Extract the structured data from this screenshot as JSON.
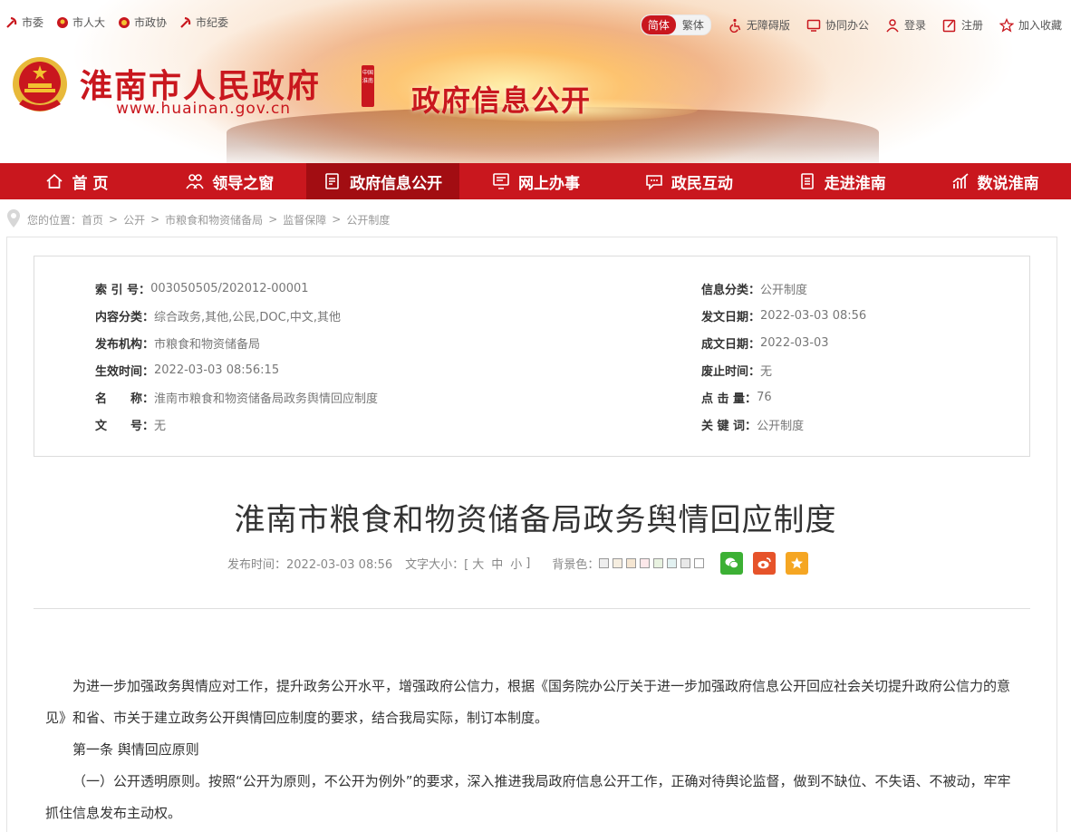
{
  "top_links": [
    "市委",
    "市人大",
    "市政协",
    "市纪委"
  ],
  "lang": {
    "simplified": "简体",
    "traditional": "繁体"
  },
  "top_right": {
    "accessibility": "无障碍版",
    "office": "协同办公",
    "login": "登录",
    "register": "注册",
    "favorite": "加入收藏"
  },
  "logo": {
    "title": "淮南市人民政府",
    "url": "www.huainan.gov.cn",
    "seal": "中国淮南",
    "site_title": "政府信息公开"
  },
  "nav": [
    {
      "label": "首 页",
      "icon": "home-icon"
    },
    {
      "label": "领导之窗",
      "icon": "people-icon"
    },
    {
      "label": "政府信息公开",
      "icon": "document-icon"
    },
    {
      "label": "网上办事",
      "icon": "computer-icon"
    },
    {
      "label": "政民互动",
      "icon": "chat-icon"
    },
    {
      "label": "走进淮南",
      "icon": "book-icon"
    },
    {
      "label": "数说淮南",
      "icon": "chart-icon"
    }
  ],
  "breadcrumb": {
    "prefix": "您的位置：",
    "items": [
      "首页",
      "公开",
      "市粮食和物资储备局",
      "监督保障",
      "公开制度"
    ],
    "sep": ">"
  },
  "meta": {
    "left": [
      {
        "k": "索 引 号：",
        "v": "003050505/202012-00001"
      },
      {
        "k": "内容分类：",
        "v": "综合政务,其他,公民,DOC,中文,其他"
      },
      {
        "k": "发布机构：",
        "v": "市粮食和物资储备局"
      },
      {
        "k": "生效时间：",
        "v": "2022-03-03 08:56:15"
      },
      {
        "k": "名　　称：",
        "v": "淮南市粮食和物资储备局政务舆情回应制度"
      },
      {
        "k": "文　　号：",
        "v": "无"
      }
    ],
    "right": [
      {
        "k": "信息分类：",
        "v": "公开制度"
      },
      {
        "k": "发文日期：",
        "v": "2022-03-03 08:56"
      },
      {
        "k": "成文日期：",
        "v": "2022-03-03"
      },
      {
        "k": "废止时间：",
        "v": "无"
      },
      {
        "k": "点 击 量：",
        "v": "76"
      },
      {
        "k": "关 键 词：",
        "v": "公开制度"
      }
    ]
  },
  "article": {
    "title": "淮南市粮食和物资储备局政务舆情回应制度",
    "publish_label": "发布时间：2022-03-03 08:56",
    "font_size_label": "文字大小：[",
    "font_sizes": [
      "大",
      "中",
      "小"
    ],
    "font_size_end": "]",
    "bg_label": "背景色：",
    "bg_colors": [
      "#eeeeee",
      "#f6eee0",
      "#f5e6d2",
      "#fde8ea",
      "#e8f2e0",
      "#e2f1f1",
      "#e8e8e8",
      "#ffffff"
    ],
    "paragraphs": [
      "为进一步加强政务舆情应对工作，提升政务公开水平，增强政府公信力，根据《国务院办公厅关于进一步加强政府信息公开回应社会关切提升政府公信力的意见》和省、市关于建立政务公开舆情回应制度的要求，结合我局实际，制订本制度。",
      "第一条  舆情回应原则",
      "（一）公开透明原则。按照“公开为原则，不公开为例外”的要求，深入推进我局政府信息公开工作，正确对待舆论监督，做到不缺位、不失语、不被动，牢牢抓住信息发布主动权。"
    ]
  },
  "colors": {
    "brand_red": "#c9171e",
    "nav_active": "#a20d12",
    "wechat": "#3cb034",
    "weibo": "#e6532a",
    "favorite": "#f5a623"
  }
}
